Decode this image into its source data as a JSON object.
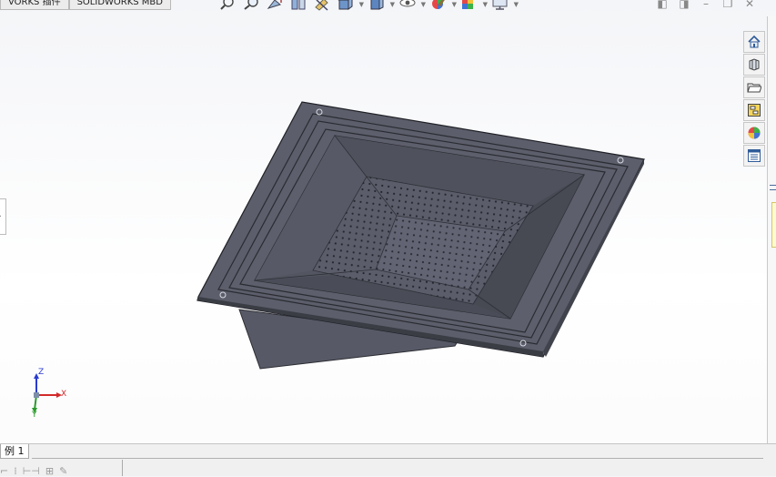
{
  "tabs": [
    {
      "label": "VORKS 插件"
    },
    {
      "label": "SOLIDWORKS MBD"
    }
  ],
  "heads_up_toolbar": {
    "buttons": [
      {
        "icon": "zoom-to-fit-icon",
        "dropdown": false
      },
      {
        "icon": "zoom-to-area-icon",
        "dropdown": false
      },
      {
        "icon": "previous-view-icon",
        "dropdown": false
      },
      {
        "icon": "section-view-icon",
        "dropdown": false
      },
      {
        "icon": "dynamic-annotation-views-icon",
        "dropdown": false
      },
      {
        "icon": "view-orientation-icon",
        "dropdown": true
      },
      {
        "icon": "display-style-icon",
        "dropdown": true
      },
      {
        "icon": "hide-show-items-icon",
        "dropdown": true
      },
      {
        "icon": "edit-appearance-icon",
        "dropdown": true
      },
      {
        "icon": "apply-scene-icon",
        "dropdown": true
      },
      {
        "icon": "view-settings-icon",
        "dropdown": true
      }
    ]
  },
  "window_controls": [
    "restore-left-icon",
    "restore-right-icon",
    "minimize-icon",
    "maximize-icon",
    "close-icon"
  ],
  "task_pane": [
    {
      "icon": "home-icon"
    },
    {
      "icon": "design-library-icon"
    },
    {
      "icon": "file-explorer-icon"
    },
    {
      "icon": "view-palette-icon"
    },
    {
      "icon": "appearances-icon"
    },
    {
      "icon": "custom-properties-icon"
    }
  ],
  "triad": {
    "x": "X",
    "y": "Y",
    "z": "Z"
  },
  "sheet_tab": {
    "label": "例 1"
  },
  "bottom_tools": [
    "sketch-tool-icon",
    "dimension-tool-icon",
    "smart-dimension-icon",
    "table-tool-icon",
    "pencil-icon"
  ]
}
